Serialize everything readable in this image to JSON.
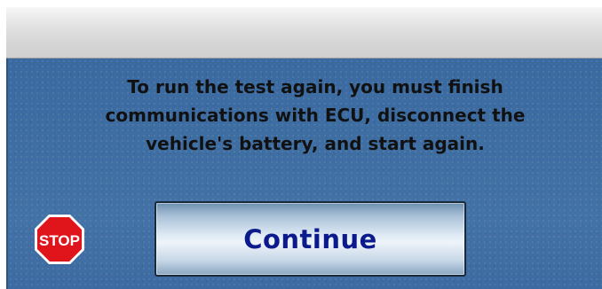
{
  "dialog": {
    "message": "To run the test again, you must finish\ncommunications with ECU, disconnect the\nvehicle's battery, and start again.",
    "continue_label": "Continue",
    "stop_icon_text": "STOP",
    "stop_icon_name": "stop-sign-icon"
  },
  "colors": {
    "background": "#3f6ea3",
    "button_text": "#0b1b8c",
    "message_text": "#111111",
    "stop_red": "#e0141b"
  }
}
